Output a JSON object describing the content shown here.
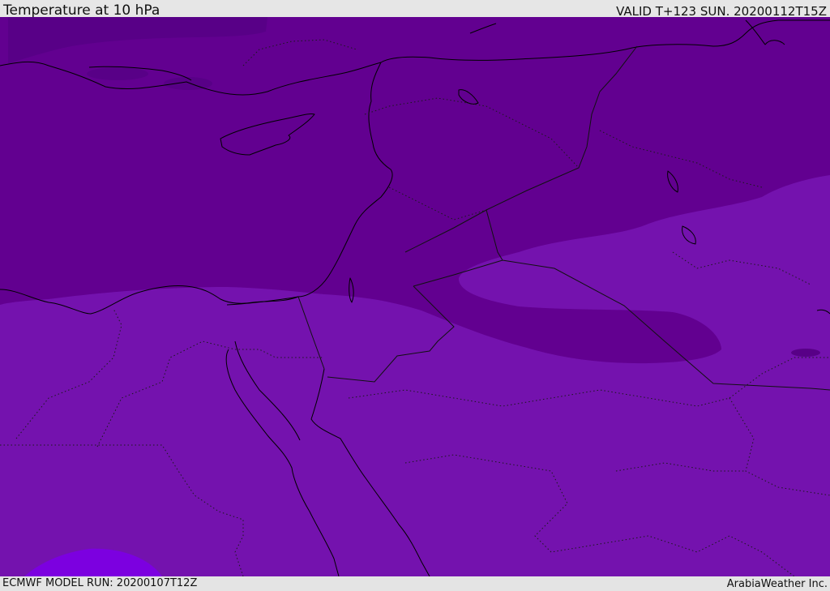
{
  "header": {
    "title": "Temperature at 10 hPa",
    "valid": "VALID T+123 SUN. 20200112T15Z"
  },
  "footer": {
    "model_run": "ECMWF MODEL RUN: 20200107T12Z",
    "credit": "ArabiaWeather Inc."
  },
  "colors": {
    "band_cold": "#620090",
    "band_colder": "#580087",
    "band_mid": "#7412ae",
    "band_warm": "#7c00e0"
  }
}
